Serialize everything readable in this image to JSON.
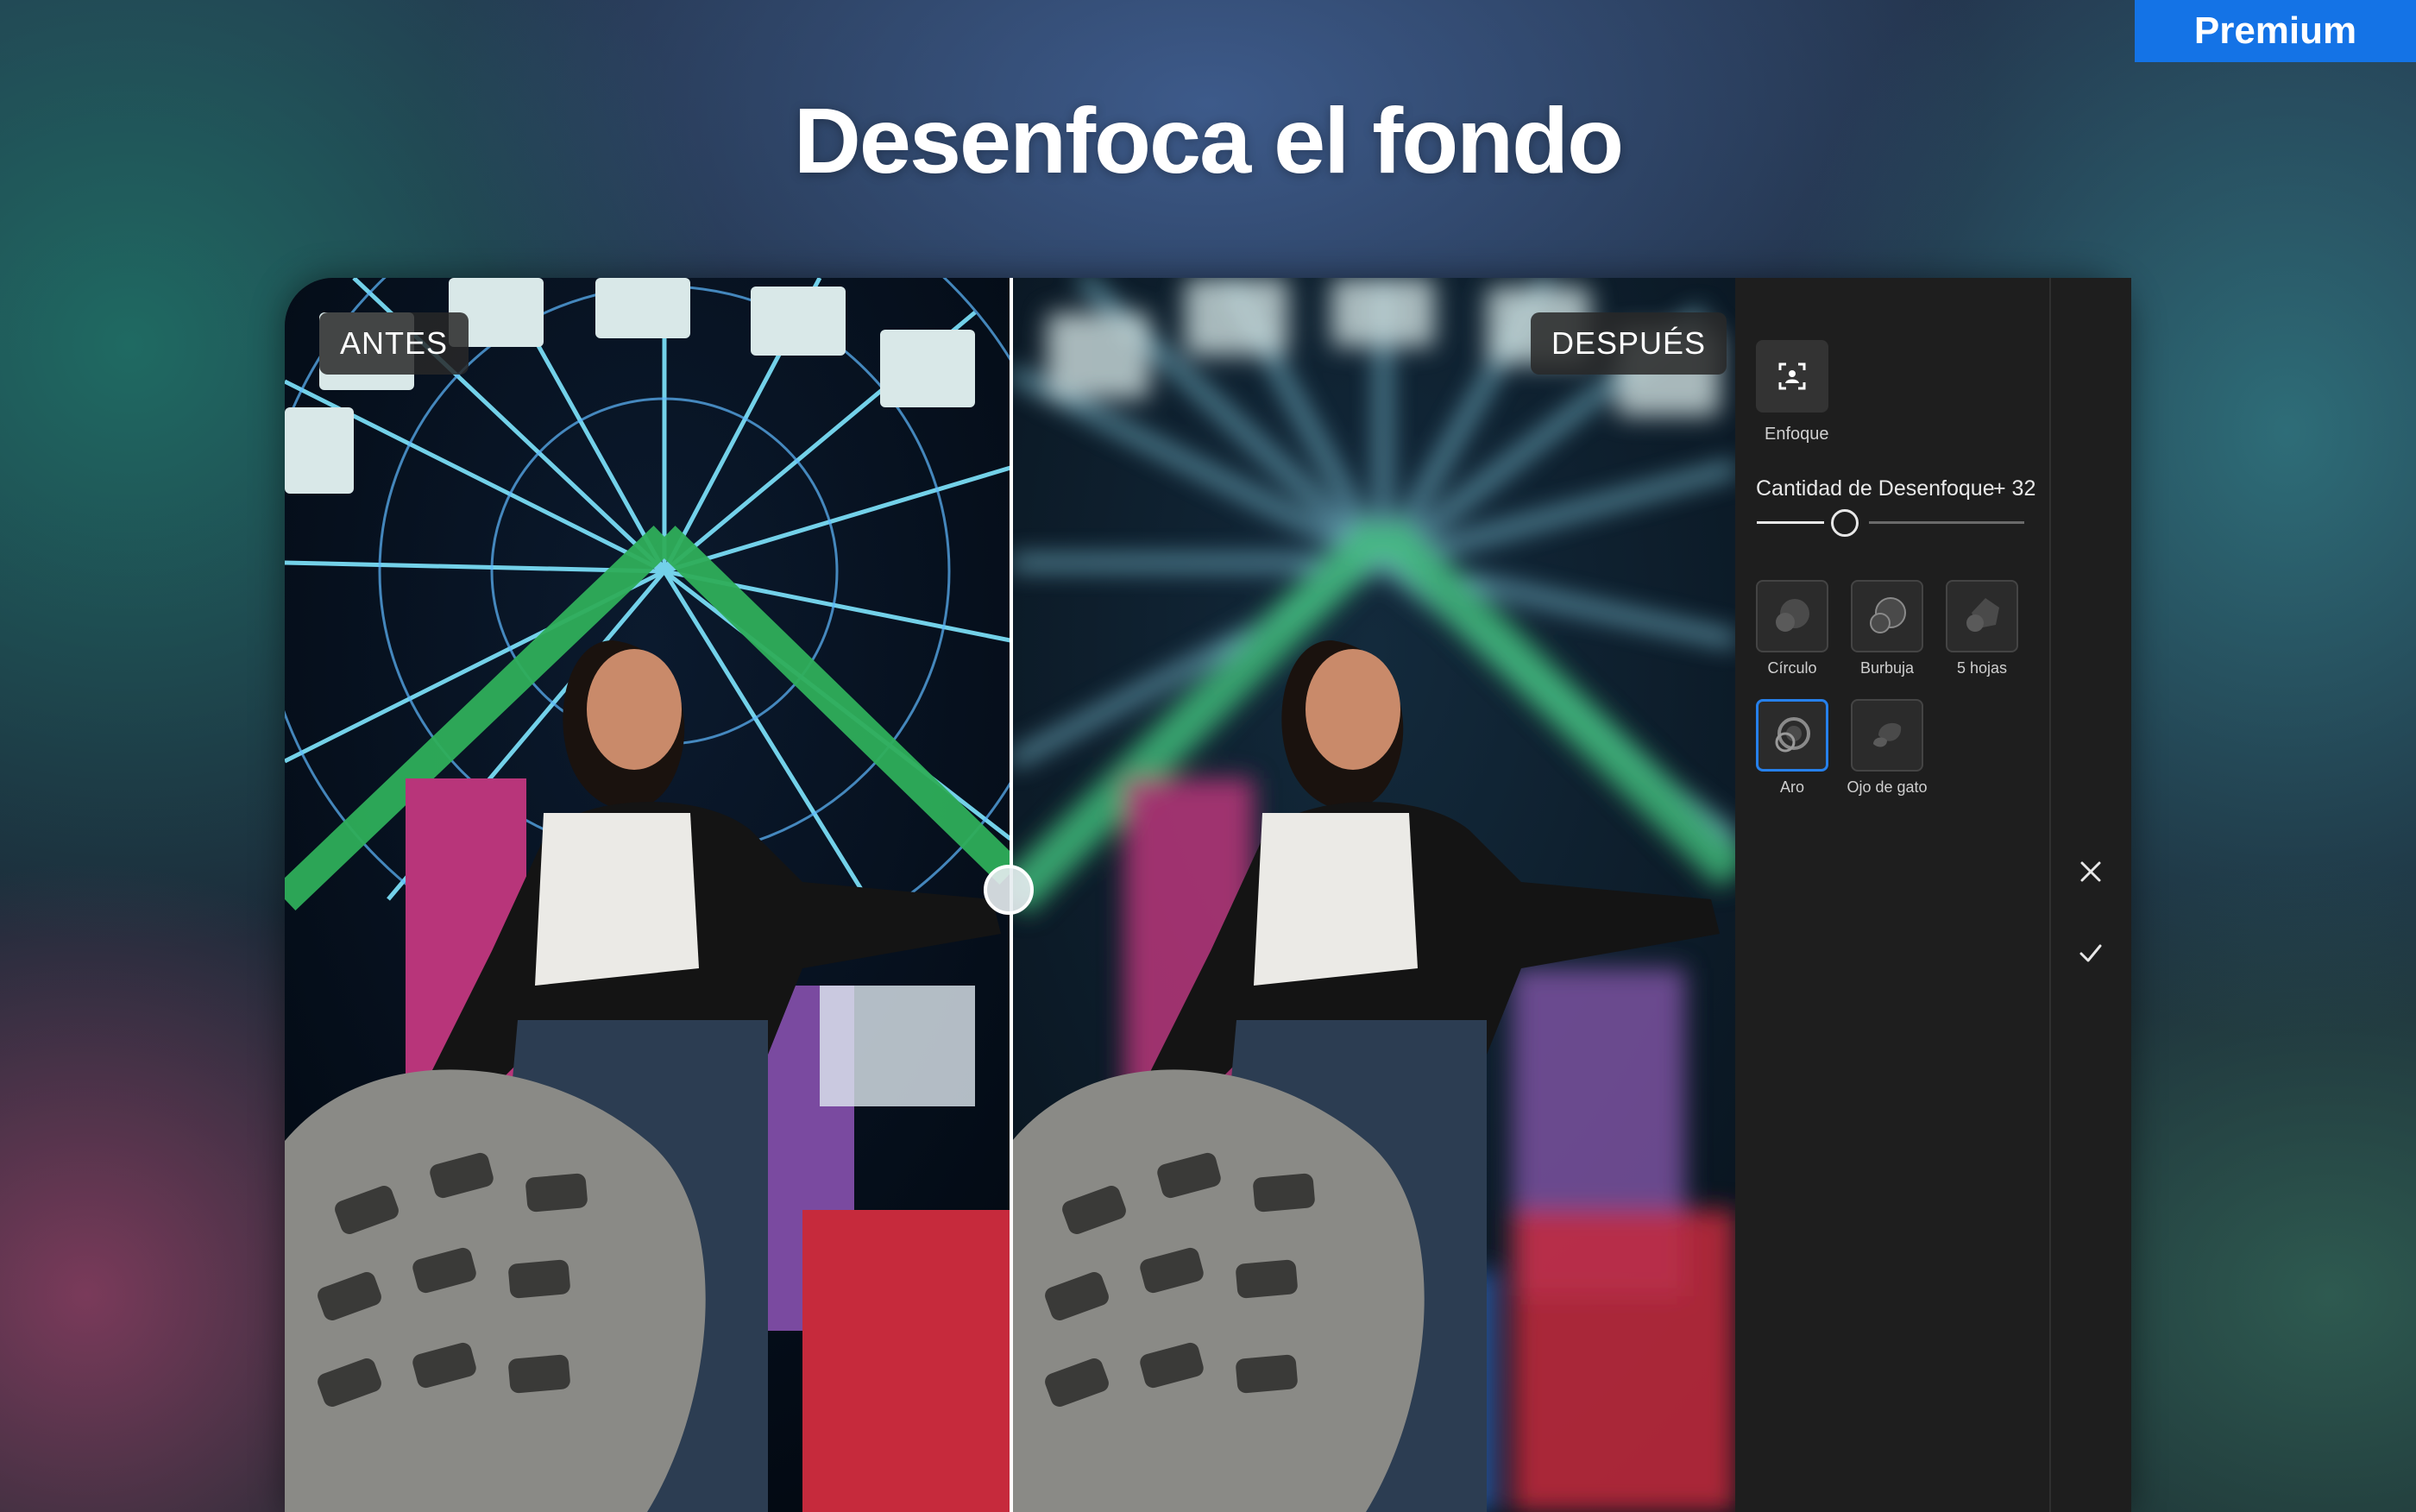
{
  "badge": {
    "label": "Premium"
  },
  "headline": {
    "text": "Desenfoca el fondo"
  },
  "compare": {
    "before_label": "ANTES",
    "after_label": "DESPUÉS"
  },
  "panel": {
    "focus_label": "Enfoque",
    "amount_label": "Cantidad de Desenfoque",
    "amount_value": "+ 32",
    "amount_level": 32,
    "shapes": [
      {
        "label": "Círculo",
        "icon": "circle-bokeh-icon",
        "selected": false
      },
      {
        "label": "Burbuja",
        "icon": "bubble-bokeh-icon",
        "selected": false
      },
      {
        "label": "5 hojas",
        "icon": "five-blade-bokeh-icon",
        "selected": false
      },
      {
        "label": "Aro",
        "icon": "ring-bokeh-icon",
        "selected": true
      },
      {
        "label": "Ojo de gato",
        "icon": "cats-eye-bokeh-icon",
        "selected": false
      }
    ]
  },
  "colors": {
    "accent": "#1473e6",
    "selected_border": "#2680eb",
    "panel_bg": "#1e1e1e"
  }
}
